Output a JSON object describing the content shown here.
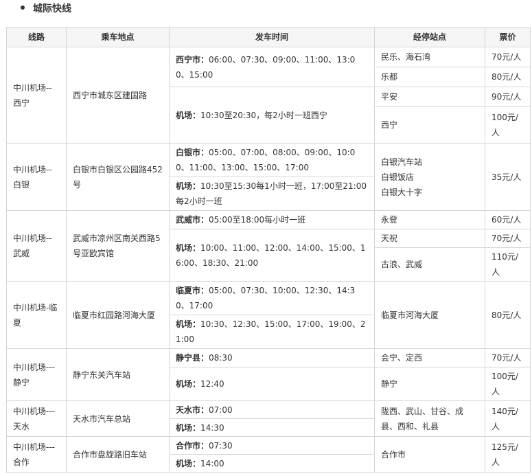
{
  "section_title": "城际快线",
  "headers": [
    "线路",
    "乘车地点",
    "发车时间",
    "经停站点",
    "票价"
  ],
  "routes": [
    {
      "name": "中川机场--西宁",
      "pickup": "西宁市城东区建国路",
      "times": [
        {
          "label": "西宁市：",
          "text": "06:00、07:30、09:00、11:00、13:00、15:00"
        },
        {
          "label": "机场：",
          "text": "10:30至20:30，每2小时一班西宁"
        }
      ],
      "stops": [
        {
          "name": "民乐、海石湾",
          "price": "70元/人"
        },
        {
          "name": "乐都",
          "price": "80元/人"
        },
        {
          "name": "平安",
          "price": "90元/人"
        },
        {
          "name": "西宁",
          "price": "100元/人"
        }
      ]
    },
    {
      "name": "中川机场--白银",
      "pickup": "白银市白银区公园路452号",
      "times": [
        {
          "label": "白银市：",
          "text": "05:00、07:00、08:00、09:00、10:00、11:00、13:00、15:00、17:00"
        },
        {
          "label": "机场：",
          "text": "10:30至15:30每1小时一班，17:00至21:00每2小时一班"
        }
      ],
      "stops_lines": [
        "白银汽车站",
        "白银饭店",
        "白银大十字"
      ],
      "price": "35元/人"
    },
    {
      "name": "中川机场--武威",
      "pickup": "武威市凉州区南关西路5号亚欧宾馆",
      "times": [
        {
          "label": "武威市：",
          "text": "05:00至18:00每小时一班"
        },
        {
          "label": "机场：",
          "text": "10:00、11:00、12:00、14:00、15:00、16:00、18:30、21:00"
        }
      ],
      "stops": [
        {
          "name": "永登",
          "price": "60元/人"
        },
        {
          "name": "天祝",
          "price": "70元/人"
        },
        {
          "name": "古浪、武威",
          "price": "110元/人"
        }
      ]
    },
    {
      "name": "中川机场-临夏",
      "pickup": "临夏市红园路河海大厦",
      "times": [
        {
          "label": "临夏市：",
          "text": "05:00、07:30、10:00、12:30、14:30、17:00"
        },
        {
          "label": "机场：",
          "text": "10:30、12:30、15:00、17:00、19:00、21:00"
        }
      ],
      "stop": "临夏市河海大厦",
      "price": "80元/人"
    },
    {
      "name": "中川机场---静宁",
      "pickup": "静宁东关汽车站",
      "times": [
        {
          "label": "静宁县：",
          "text": "08:30"
        },
        {
          "label": "机场：",
          "text": "12:40"
        }
      ],
      "stops": [
        {
          "name": "会宁、定西",
          "price": "70元/人"
        },
        {
          "name": "静宁",
          "price": "100元/人"
        }
      ]
    },
    {
      "name": "中川机场---天水",
      "pickup": "天水市汽车总站",
      "times": [
        {
          "label": "天水市：",
          "text": "07:00"
        },
        {
          "label": "机场：",
          "text": "14:30"
        }
      ],
      "stop": "陇西、武山、甘谷、成县、西和、礼县",
      "price": "140元/人"
    },
    {
      "name": "中川机场---合作",
      "pickup": "合作市盘旋路旧车站",
      "times": [
        {
          "label": "合作市：",
          "text": "07:30"
        },
        {
          "label": "机场：",
          "text": "14:00"
        }
      ],
      "stop": "合作市",
      "price": "125元/人"
    }
  ]
}
